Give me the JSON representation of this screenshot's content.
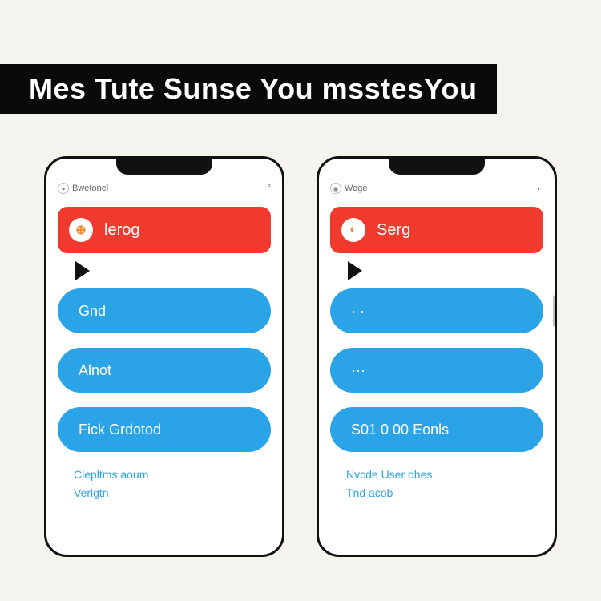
{
  "header": {
    "title": "Mes Tute Sunse You msstesYou"
  },
  "colors": {
    "accent_red": "#ef3a2d",
    "accent_blue": "#2aa4e7",
    "title_bg": "#0a0a0a",
    "page_bg": "#f4f3ee"
  },
  "phones": [
    {
      "status_label": "Bwetonel",
      "status_right": "°",
      "red_label": "lerog",
      "options": [
        "Gnd",
        "Alnot",
        "Fick Grdotod"
      ],
      "links": [
        "Clepltms aoum",
        "Verigtn"
      ]
    },
    {
      "status_label": "Woge",
      "status_right": "⌐",
      "red_label": "Serg",
      "options": [
        "· ·",
        "···",
        "S01 0 00 Eonls"
      ],
      "links": [
        "Nvcde User ohes",
        "Tnd acob"
      ]
    }
  ]
}
